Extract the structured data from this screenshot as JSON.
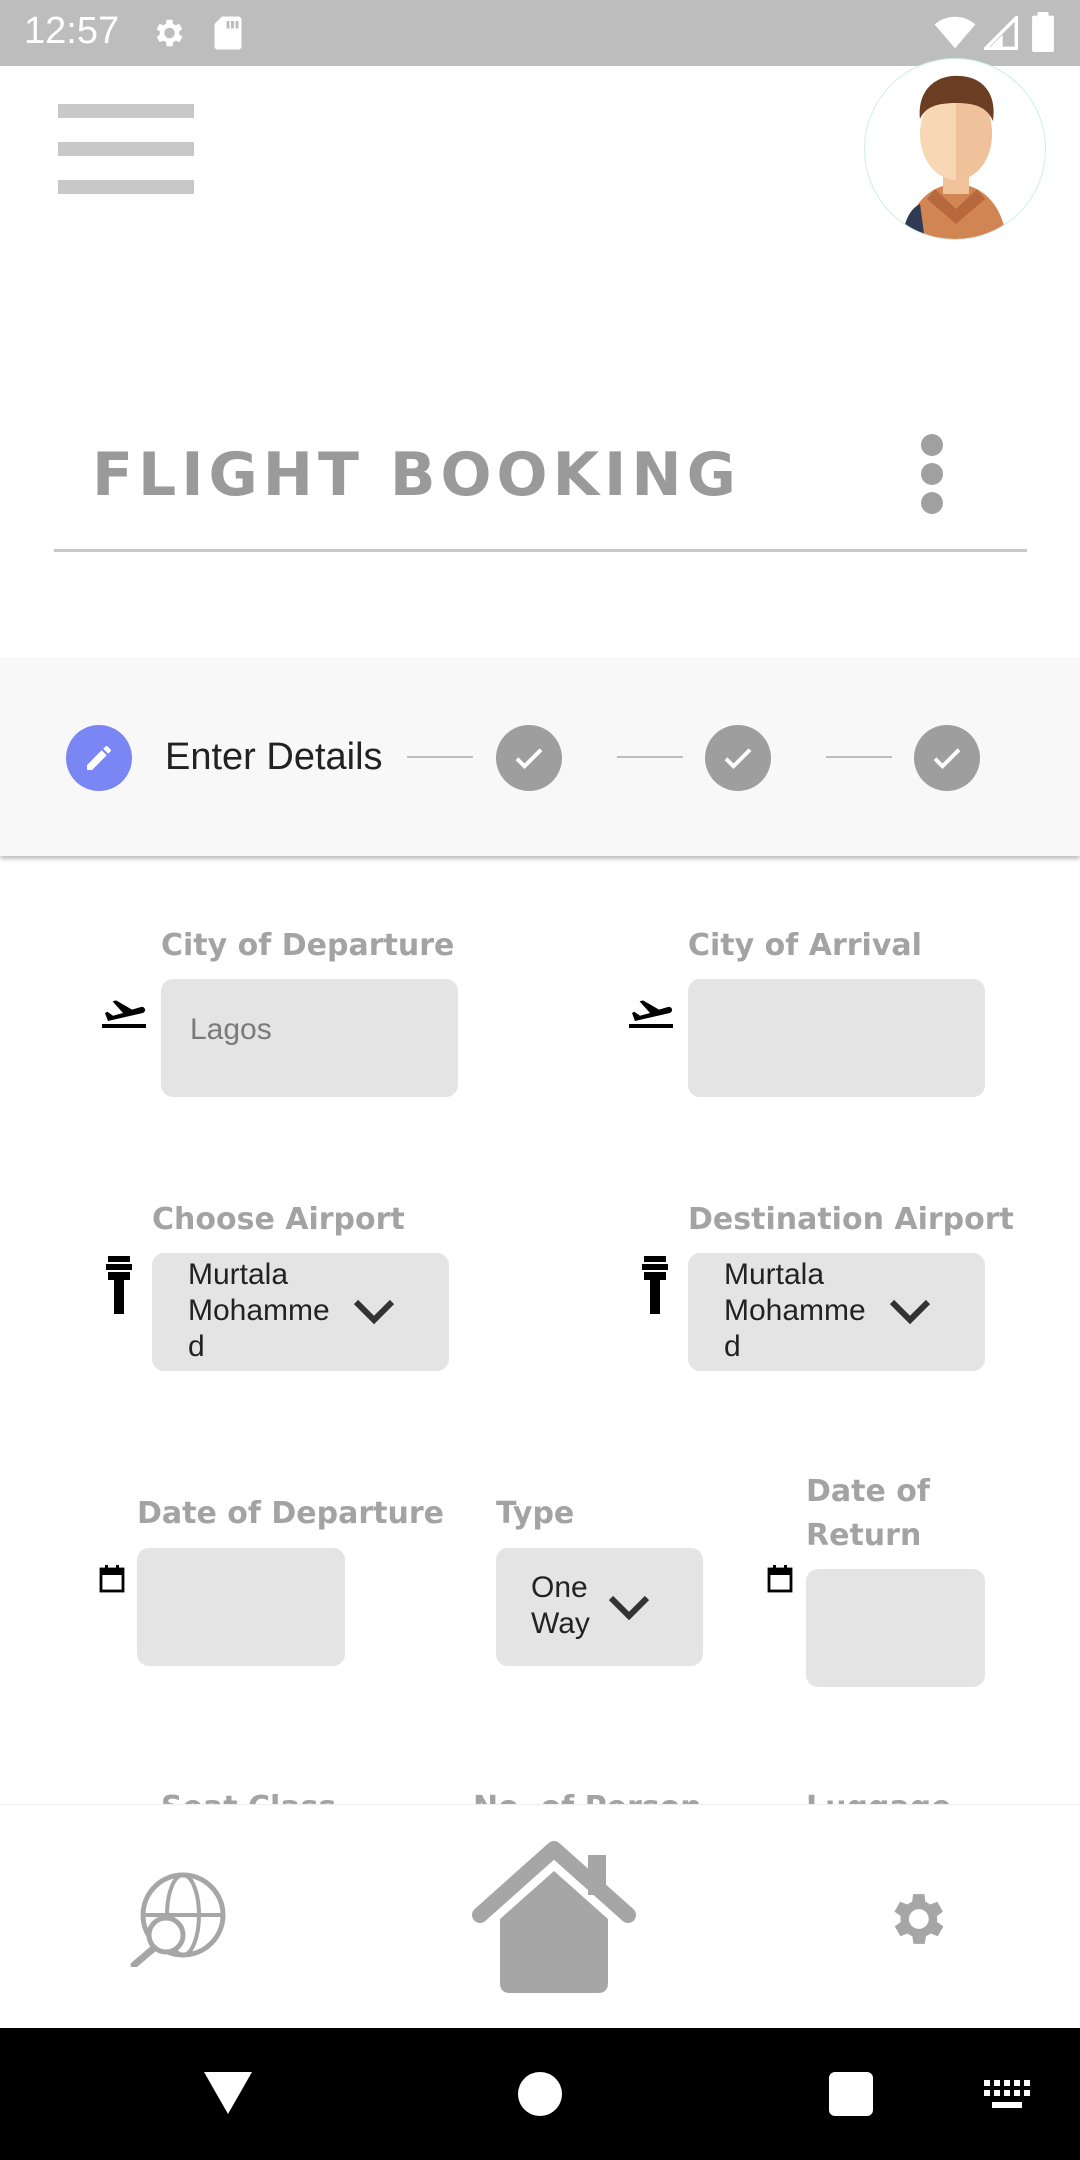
{
  "status_bar": {
    "time": "12:57",
    "icons": [
      "settings-icon",
      "sd-card-icon",
      "wifi-icon",
      "signal-icon",
      "battery-icon"
    ]
  },
  "header": {
    "title": "FLIGHT BOOKING",
    "menu_icon": "hamburger-icon",
    "overflow_icon": "more-vert-icon"
  },
  "stepper": {
    "current_label": "Enter Details",
    "accent": "#7b86f5",
    "done_color": "#9e9e9e"
  },
  "form": {
    "city_departure": {
      "label": "City of Departure",
      "value": "Lagos"
    },
    "city_arrival": {
      "label": "City of Arrival",
      "value": ""
    },
    "choose_airport": {
      "label": "Choose Airport",
      "value_line1": "Murtala",
      "value_line2": "Mohamme",
      "value_line3": "d"
    },
    "destination_airport": {
      "label": "Destination Airport",
      "value_line1": "Murtala",
      "value_line2": "Mohamme",
      "value_line3": "d"
    },
    "date_departure": {
      "label": "Date of Departure",
      "value": ""
    },
    "type": {
      "label": "Type",
      "value_line1": "One",
      "value_line2": "Way"
    },
    "date_return": {
      "label_line1": "Date of",
      "label_line2": "Return",
      "value": ""
    },
    "cut_labels": [
      "Seat Class",
      "No. of Person",
      "Luggage"
    ]
  },
  "bottom_nav": {
    "items": [
      "globe-search-icon",
      "home-icon",
      "gear-icon"
    ]
  },
  "colors": {
    "status_bar": "#bdbdbd",
    "field_bg": "#e4e4e4",
    "label": "#a3a3a3",
    "icon_gray": "#a6a6a6"
  }
}
